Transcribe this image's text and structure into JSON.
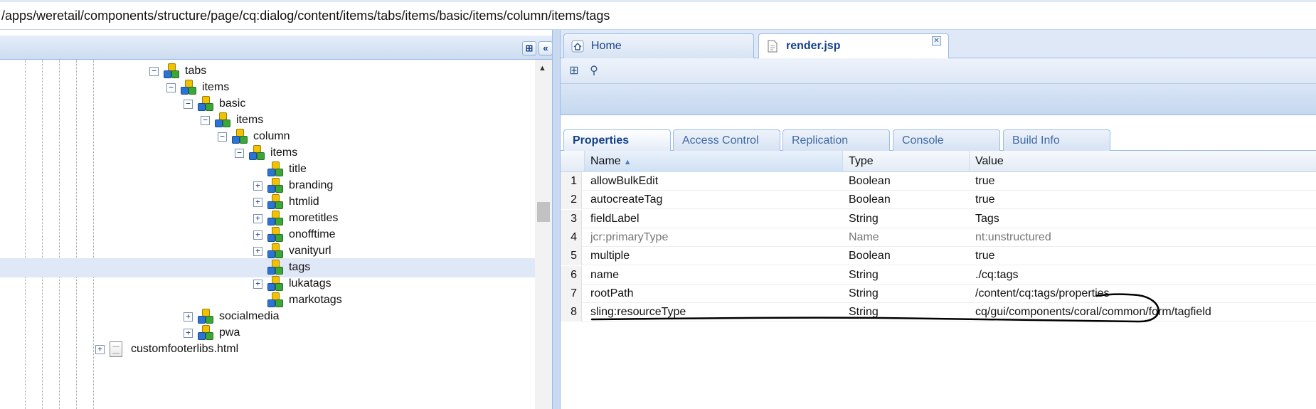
{
  "path_bar": {
    "path": "/apps/weretail/components/structure/page/cq:dialog/content/items/tabs/items/basic/items/column/items/tags"
  },
  "tree": {
    "collapse_icon": "binoculars-icon",
    "collapse_panel_icon": "double-chevron-left-icon",
    "nodes": [
      {
        "label": "tabs",
        "expander": "⊟",
        "kind": "node"
      },
      {
        "label": "items",
        "expander": "⊟",
        "kind": "node"
      },
      {
        "label": "basic",
        "expander": "⊟",
        "kind": "node"
      },
      {
        "label": "items",
        "expander": "⊟",
        "kind": "node"
      },
      {
        "label": "column",
        "expander": "⊟",
        "kind": "node"
      },
      {
        "label": "items",
        "expander": "⊟",
        "kind": "node"
      },
      {
        "label": "title",
        "expander": "",
        "kind": "node"
      },
      {
        "label": "branding",
        "expander": "⊞",
        "kind": "node"
      },
      {
        "label": "htmlid",
        "expander": "⊞",
        "kind": "node"
      },
      {
        "label": "moretitles",
        "expander": "⊞",
        "kind": "node"
      },
      {
        "label": "onofftime",
        "expander": "⊞",
        "kind": "node"
      },
      {
        "label": "vanityurl",
        "expander": "⊞",
        "kind": "node"
      },
      {
        "label": "tags",
        "expander": "",
        "kind": "node",
        "selected": true
      },
      {
        "label": "lukatags",
        "expander": "⊞",
        "kind": "node"
      },
      {
        "label": "markotags",
        "expander": "",
        "kind": "node"
      },
      {
        "label": "socialmedia",
        "expander": "⊞",
        "kind": "node"
      },
      {
        "label": "pwa",
        "expander": "⊞",
        "kind": "node"
      },
      {
        "label": "customfooterlibs.html",
        "expander": "⊞",
        "kind": "file"
      }
    ]
  },
  "editor_tabs": [
    {
      "label": "Home",
      "icon": "home-icon"
    },
    {
      "label": "render.jsp",
      "icon": "file-icon",
      "close": "✕"
    }
  ],
  "toolbar": {
    "buttons": [
      {
        "icon": "tree-view-icon",
        "glyph": "⊞"
      },
      {
        "icon": "binoculars-icon",
        "glyph": "⚲"
      }
    ]
  },
  "property_tabs": [
    "Properties",
    "Access Control",
    "Replication",
    "Console",
    "Build Info"
  ],
  "grid": {
    "columns": {
      "name": "Name",
      "type": "Type",
      "value": "Value"
    },
    "sort_indicator": "▲",
    "rows": [
      {
        "num": "1",
        "name": "allowBulkEdit",
        "type": "Boolean",
        "value": "true"
      },
      {
        "num": "2",
        "name": "autocreateTag",
        "type": "Boolean",
        "value": "true"
      },
      {
        "num": "3",
        "name": "fieldLabel",
        "type": "String",
        "value": "Tags"
      },
      {
        "num": "4",
        "name": "jcr:primaryType",
        "type": "Name",
        "value": "nt:unstructured",
        "dim": true
      },
      {
        "num": "5",
        "name": "multiple",
        "type": "Boolean",
        "value": "true"
      },
      {
        "num": "6",
        "name": "name",
        "type": "String",
        "value": "./cq:tags"
      },
      {
        "num": "7",
        "name": "rootPath",
        "type": "String",
        "value": "/content/cq:tags/properties"
      },
      {
        "num": "8",
        "name": "sling:resourceType",
        "type": "String",
        "value": "cq/gui/components/coral/common/form/tagfield"
      }
    ]
  },
  "colors": {
    "accent_blue": "#15428b",
    "selection": "#dfe8f6",
    "annotation_ink": "#000000"
  }
}
